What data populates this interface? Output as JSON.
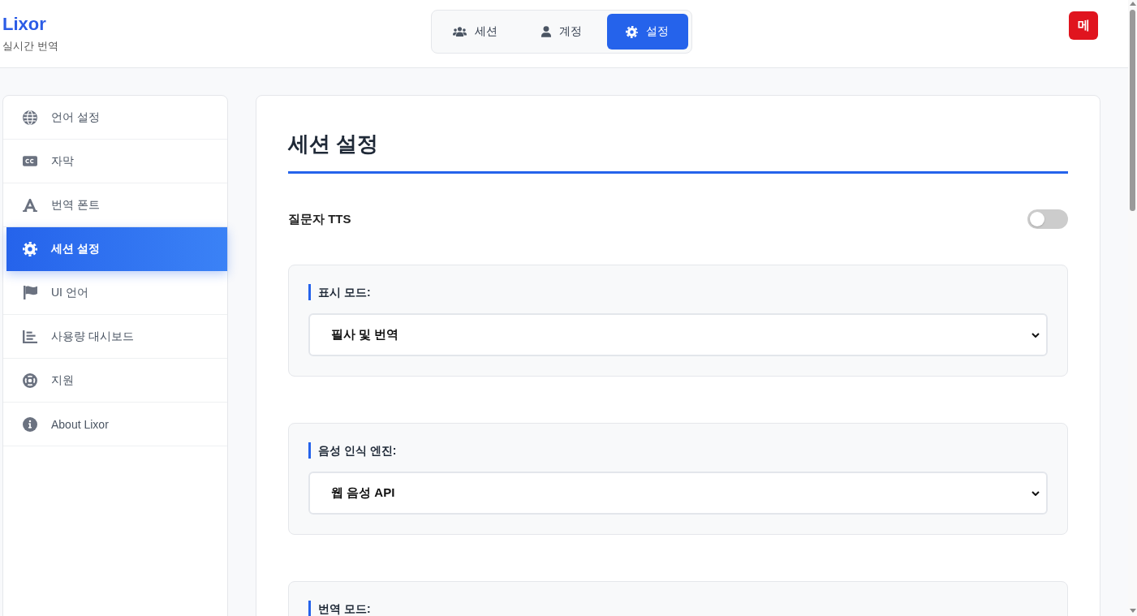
{
  "header": {
    "logo": "Lixor",
    "subtitle": "실시간 번역",
    "badge": "메"
  },
  "nav_tabs": [
    {
      "label": "세션",
      "selected": false
    },
    {
      "label": "계정",
      "selected": false
    },
    {
      "label": "설정",
      "selected": true
    }
  ],
  "sidebar": {
    "items": [
      {
        "label": "언어 설정",
        "selected": false
      },
      {
        "label": "자막",
        "selected": false
      },
      {
        "label": "번역 폰트",
        "selected": false
      },
      {
        "label": "세션 설정",
        "selected": true
      },
      {
        "label": "UI 언어",
        "selected": false
      },
      {
        "label": "사용량 대시보드",
        "selected": false
      },
      {
        "label": "지원",
        "selected": false
      },
      {
        "label": "About Lixor",
        "selected": false
      }
    ]
  },
  "panel": {
    "title": "세션 설정",
    "toggle": {
      "label": "질문자 TTS",
      "on": false
    },
    "sections": [
      {
        "label": "표시 모드:",
        "value": "필사 및 번역"
      },
      {
        "label": "음성 인식 엔진:",
        "value": "웹 음성 API"
      },
      {
        "label": "번역 모드:"
      }
    ]
  }
}
